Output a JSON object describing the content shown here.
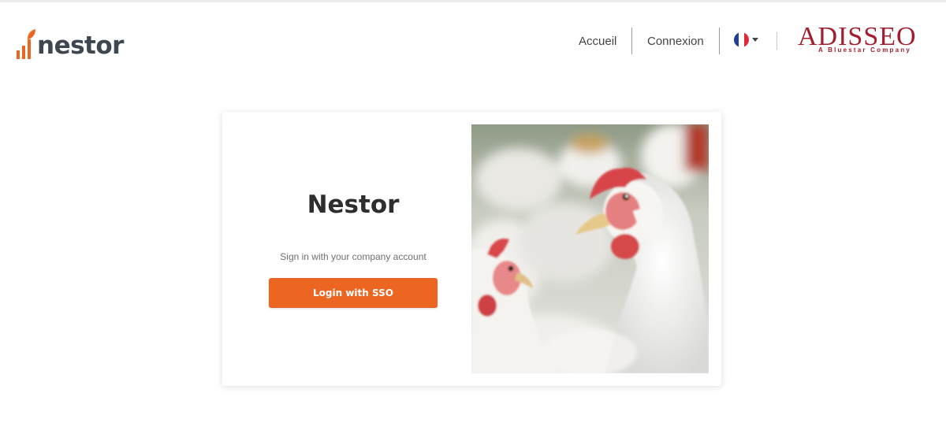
{
  "header": {
    "logo_text": "nestor",
    "nav": {
      "home": "Accueil",
      "login": "Connexion"
    },
    "language": {
      "current": "FR",
      "flag_colors": [
        "#1f3f9c",
        "#ffffff",
        "#e0283a"
      ]
    },
    "partner": {
      "name": "ADISSEO",
      "tagline": "A Bluestar Company",
      "color": "#a31d2e"
    }
  },
  "card": {
    "title": "Nestor",
    "subtitle": "Sign in with your company account",
    "sso_button": "Login with SSO",
    "image_alt": "white-chickens-photo"
  },
  "colors": {
    "accent": "#ec6622",
    "logo_text": "#3e4650"
  }
}
